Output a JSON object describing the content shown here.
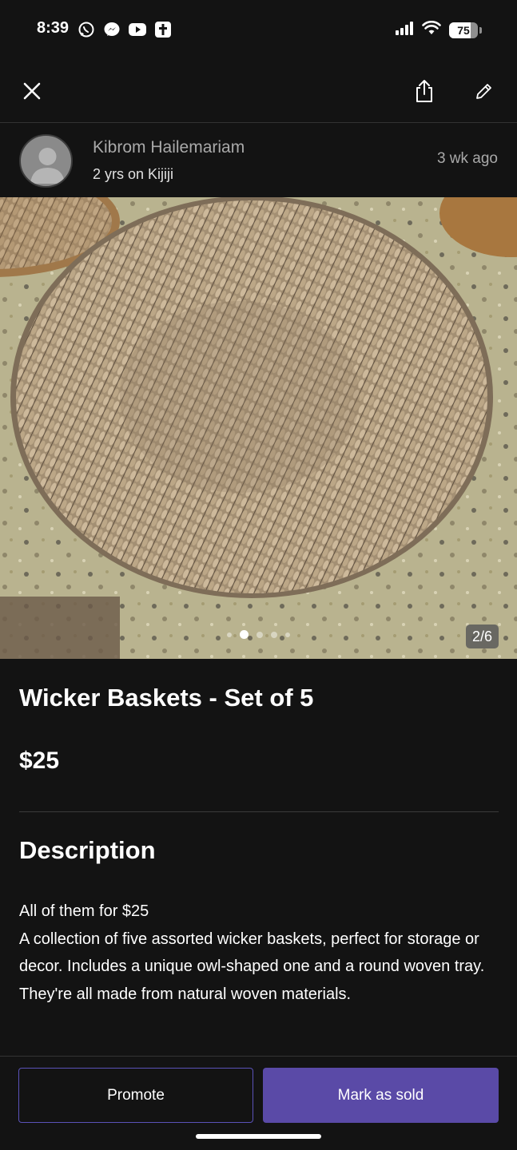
{
  "status_bar": {
    "time": "8:39",
    "apps": [
      "whatsapp-icon",
      "messenger-icon",
      "youtube-icon",
      "bible-icon"
    ],
    "battery_level": "75",
    "battery_fraction": 0.75
  },
  "topbar": {
    "close_icon": "close-icon",
    "share_icon": "share-icon",
    "edit_icon": "pencil-icon"
  },
  "seller": {
    "name": "Kibrom Hailemariam",
    "tenure": "2 yrs on Kijiji",
    "posted": "3 wk  ago"
  },
  "gallery": {
    "counter": "2/6",
    "total_images": 6,
    "current_index": 2
  },
  "listing": {
    "title": "Wicker Baskets - Set of 5",
    "price": "$25",
    "description_heading": "Description",
    "description_line1": "All of them for $25",
    "description_body": "A collection of five assorted wicker baskets, perfect for storage or decor. Includes a unique owl-shaped one and a round woven tray. They're all made from natural woven materials."
  },
  "actions": {
    "promote_label": "Promote",
    "mark_sold_label": "Mark as sold"
  },
  "colors": {
    "background": "#131313",
    "accent": "#5a4aa7",
    "muted_text": "#a9a9a9"
  }
}
